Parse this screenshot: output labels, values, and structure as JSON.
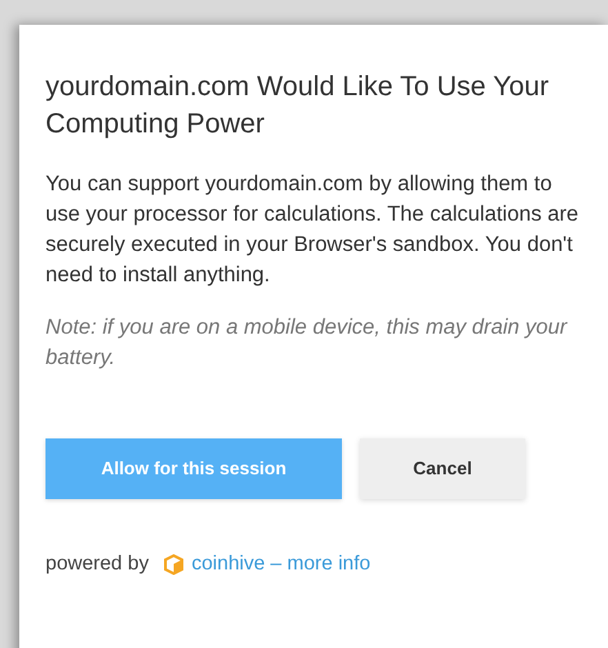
{
  "dialog": {
    "title": "yourdomain.com Would Like To Use Your Computing Power",
    "message": "You can support yourdomain.com by allowing them to use your processor for calculations. The calculations are securely executed in your Browser's sandbox. You don't need to install anything.",
    "note": "Note: if you are on a mobile device, this may drain your battery.",
    "buttons": [
      {
        "label": "Allow for this session",
        "kind": "primary"
      },
      {
        "label": "Cancel",
        "kind": "secondary"
      }
    ],
    "footer": {
      "prefix": "powered by",
      "brand_link": "coinhive",
      "separator": "–",
      "info_link": "more info"
    }
  }
}
